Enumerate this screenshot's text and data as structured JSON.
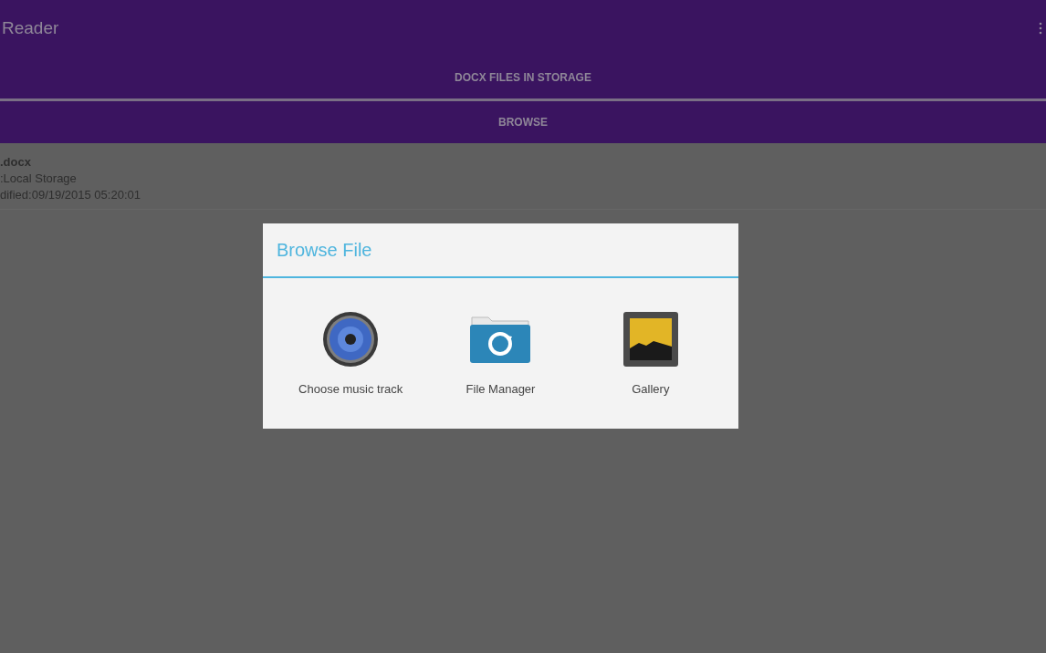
{
  "app_bar": {
    "title": "Reader"
  },
  "actions": [
    {
      "label": "DOCX FILES IN STORAGE"
    },
    {
      "label": "BROWSE"
    }
  ],
  "file_list": [
    {
      "name": ".docx",
      "location": ":Local Storage",
      "modified": "dified:09/19/2015 05:20:01"
    }
  ],
  "dialog": {
    "title": "Browse File",
    "options": [
      {
        "kind": "music",
        "label": "Choose music track"
      },
      {
        "kind": "folder",
        "label": "File Manager"
      },
      {
        "kind": "gallery",
        "label": "Gallery"
      }
    ]
  }
}
